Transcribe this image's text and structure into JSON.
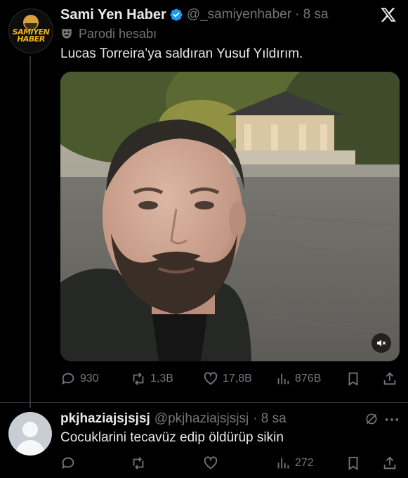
{
  "tweet": {
    "author_name": "Sami Yen Haber",
    "author_handle": "@_samiyenhaber",
    "time": "· 8 sa",
    "parody_label": "Parodi hesabı",
    "text": "Lucas Torreira’ya saldıran Yusuf Yıldırım.",
    "avatar_logo_text_1": "SAMIYEN",
    "avatar_logo_text_2": "HABER",
    "stats": {
      "replies": "930",
      "retweets": "1,3B",
      "likes": "17,8B",
      "views": "876B"
    }
  },
  "reply": {
    "author_name": "pkjhaziajsjsjsj",
    "author_handle": "@pkjhaziajsjsjsj",
    "time": "· 8 sa",
    "text": "Cocuklarini tecavüz edip öldürüp sikin",
    "stats": {
      "replies": "",
      "retweets": "",
      "likes": "",
      "views": "272"
    }
  },
  "colors": {
    "background": "#000000",
    "text_primary": "#e7e9ea",
    "text_secondary": "#71767b",
    "verified_blue": "#1d9bf0",
    "divider": "#2f3336"
  },
  "icons": [
    "verified-badge-icon",
    "x-logo-icon",
    "parody-mask-icon",
    "reply-icon",
    "retweet-icon",
    "like-icon",
    "views-icon",
    "bookmark-icon",
    "share-icon",
    "mute-icon",
    "grok-icon",
    "more-icon"
  ]
}
